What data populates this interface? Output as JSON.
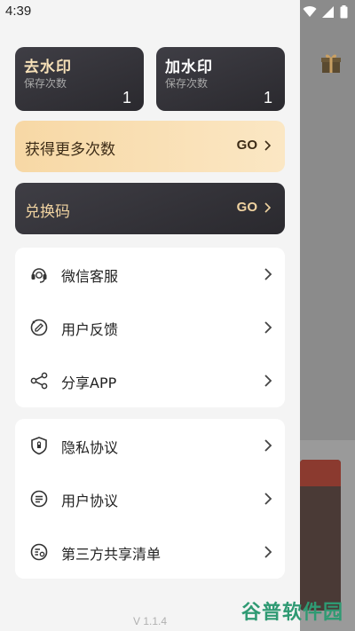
{
  "status_bar": {
    "time": "4:39"
  },
  "cards": {
    "remove": {
      "title": "去水印",
      "subtitle": "保存次数",
      "count": "1"
    },
    "add": {
      "title": "加水印",
      "subtitle": "保存次数",
      "count": "1"
    }
  },
  "more_bar": {
    "label": "获得更多次数",
    "go": "GO"
  },
  "redeem_bar": {
    "label": "兑换码",
    "go": "GO"
  },
  "menu_group_1": [
    {
      "label": "微信客服",
      "icon": "headset-icon"
    },
    {
      "label": "用户反馈",
      "icon": "feedback-icon"
    },
    {
      "label": "分享APP",
      "icon": "share-icon"
    }
  ],
  "menu_group_2": [
    {
      "label": "隐私协议",
      "icon": "shield-icon"
    },
    {
      "label": "用户协议",
      "icon": "agreement-icon"
    },
    {
      "label": "第三方共享清单",
      "icon": "list-icon"
    }
  ],
  "version": "V 1.1.4",
  "watermark": "谷普软件园",
  "colors": {
    "dark_card": "#333238",
    "gold": "#f7d8a5",
    "gold_text": "#f0d3a1",
    "drawer_bg": "#f4f4f4"
  }
}
